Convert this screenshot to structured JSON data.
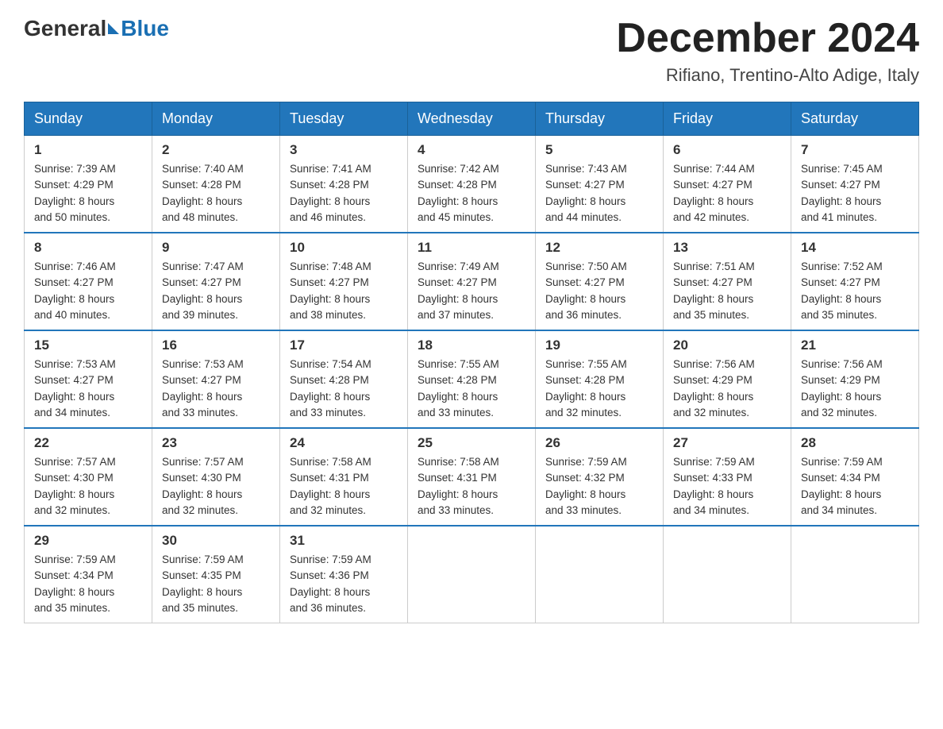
{
  "header": {
    "logo_general": "General",
    "logo_blue": "Blue",
    "month_title": "December 2024",
    "location": "Rifiano, Trentino-Alto Adige, Italy"
  },
  "weekdays": [
    "Sunday",
    "Monday",
    "Tuesday",
    "Wednesday",
    "Thursday",
    "Friday",
    "Saturday"
  ],
  "weeks": [
    [
      {
        "day": "1",
        "sunrise": "7:39 AM",
        "sunset": "4:29 PM",
        "daylight": "8 hours and 50 minutes."
      },
      {
        "day": "2",
        "sunrise": "7:40 AM",
        "sunset": "4:28 PM",
        "daylight": "8 hours and 48 minutes."
      },
      {
        "day": "3",
        "sunrise": "7:41 AM",
        "sunset": "4:28 PM",
        "daylight": "8 hours and 46 minutes."
      },
      {
        "day": "4",
        "sunrise": "7:42 AM",
        "sunset": "4:28 PM",
        "daylight": "8 hours and 45 minutes."
      },
      {
        "day": "5",
        "sunrise": "7:43 AM",
        "sunset": "4:27 PM",
        "daylight": "8 hours and 44 minutes."
      },
      {
        "day": "6",
        "sunrise": "7:44 AM",
        "sunset": "4:27 PM",
        "daylight": "8 hours and 42 minutes."
      },
      {
        "day": "7",
        "sunrise": "7:45 AM",
        "sunset": "4:27 PM",
        "daylight": "8 hours and 41 minutes."
      }
    ],
    [
      {
        "day": "8",
        "sunrise": "7:46 AM",
        "sunset": "4:27 PM",
        "daylight": "8 hours and 40 minutes."
      },
      {
        "day": "9",
        "sunrise": "7:47 AM",
        "sunset": "4:27 PM",
        "daylight": "8 hours and 39 minutes."
      },
      {
        "day": "10",
        "sunrise": "7:48 AM",
        "sunset": "4:27 PM",
        "daylight": "8 hours and 38 minutes."
      },
      {
        "day": "11",
        "sunrise": "7:49 AM",
        "sunset": "4:27 PM",
        "daylight": "8 hours and 37 minutes."
      },
      {
        "day": "12",
        "sunrise": "7:50 AM",
        "sunset": "4:27 PM",
        "daylight": "8 hours and 36 minutes."
      },
      {
        "day": "13",
        "sunrise": "7:51 AM",
        "sunset": "4:27 PM",
        "daylight": "8 hours and 35 minutes."
      },
      {
        "day": "14",
        "sunrise": "7:52 AM",
        "sunset": "4:27 PM",
        "daylight": "8 hours and 35 minutes."
      }
    ],
    [
      {
        "day": "15",
        "sunrise": "7:53 AM",
        "sunset": "4:27 PM",
        "daylight": "8 hours and 34 minutes."
      },
      {
        "day": "16",
        "sunrise": "7:53 AM",
        "sunset": "4:27 PM",
        "daylight": "8 hours and 33 minutes."
      },
      {
        "day": "17",
        "sunrise": "7:54 AM",
        "sunset": "4:28 PM",
        "daylight": "8 hours and 33 minutes."
      },
      {
        "day": "18",
        "sunrise": "7:55 AM",
        "sunset": "4:28 PM",
        "daylight": "8 hours and 33 minutes."
      },
      {
        "day": "19",
        "sunrise": "7:55 AM",
        "sunset": "4:28 PM",
        "daylight": "8 hours and 32 minutes."
      },
      {
        "day": "20",
        "sunrise": "7:56 AM",
        "sunset": "4:29 PM",
        "daylight": "8 hours and 32 minutes."
      },
      {
        "day": "21",
        "sunrise": "7:56 AM",
        "sunset": "4:29 PM",
        "daylight": "8 hours and 32 minutes."
      }
    ],
    [
      {
        "day": "22",
        "sunrise": "7:57 AM",
        "sunset": "4:30 PM",
        "daylight": "8 hours and 32 minutes."
      },
      {
        "day": "23",
        "sunrise": "7:57 AM",
        "sunset": "4:30 PM",
        "daylight": "8 hours and 32 minutes."
      },
      {
        "day": "24",
        "sunrise": "7:58 AM",
        "sunset": "4:31 PM",
        "daylight": "8 hours and 32 minutes."
      },
      {
        "day": "25",
        "sunrise": "7:58 AM",
        "sunset": "4:31 PM",
        "daylight": "8 hours and 33 minutes."
      },
      {
        "day": "26",
        "sunrise": "7:59 AM",
        "sunset": "4:32 PM",
        "daylight": "8 hours and 33 minutes."
      },
      {
        "day": "27",
        "sunrise": "7:59 AM",
        "sunset": "4:33 PM",
        "daylight": "8 hours and 34 minutes."
      },
      {
        "day": "28",
        "sunrise": "7:59 AM",
        "sunset": "4:34 PM",
        "daylight": "8 hours and 34 minutes."
      }
    ],
    [
      {
        "day": "29",
        "sunrise": "7:59 AM",
        "sunset": "4:34 PM",
        "daylight": "8 hours and 35 minutes."
      },
      {
        "day": "30",
        "sunrise": "7:59 AM",
        "sunset": "4:35 PM",
        "daylight": "8 hours and 35 minutes."
      },
      {
        "day": "31",
        "sunrise": "7:59 AM",
        "sunset": "4:36 PM",
        "daylight": "8 hours and 36 minutes."
      },
      null,
      null,
      null,
      null
    ]
  ],
  "labels": {
    "sunrise": "Sunrise:",
    "sunset": "Sunset:",
    "daylight": "Daylight:"
  }
}
